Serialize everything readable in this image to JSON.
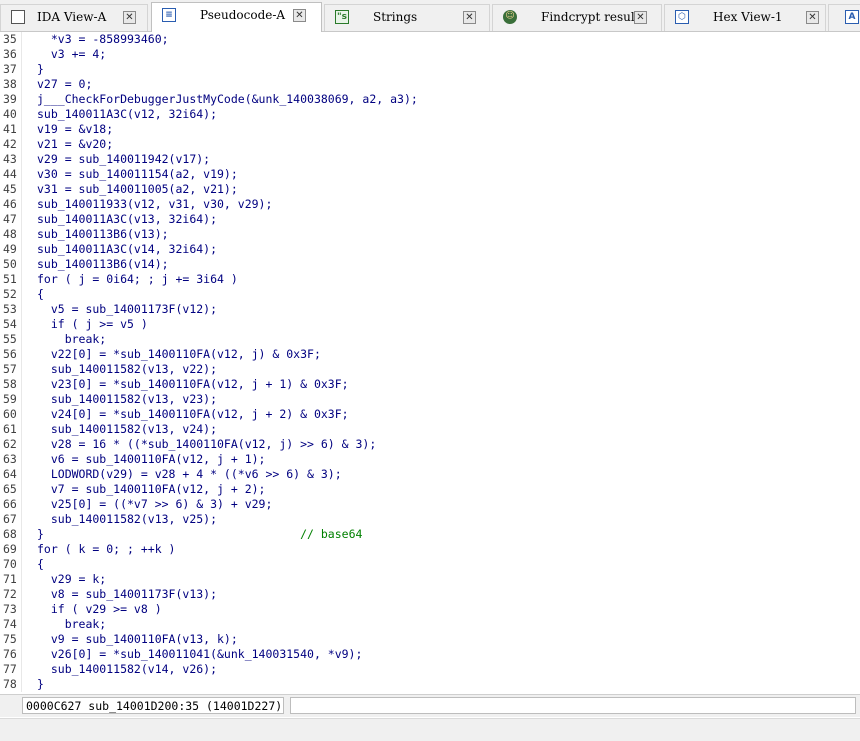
{
  "tabs": [
    {
      "label": "IDA View-A",
      "icon": "ida-view-icon",
      "active": false,
      "closable": true
    },
    {
      "label": "Pseudocode-A",
      "icon": "pseudocode-icon",
      "active": true,
      "closable": true
    },
    {
      "label": "Strings",
      "icon": "strings-icon",
      "active": false,
      "closable": true
    },
    {
      "label": "Findcrypt results",
      "icon": "findcrypt-icon",
      "active": false,
      "closable": true
    },
    {
      "label": "Hex View-1",
      "icon": "hex-view-icon",
      "active": false,
      "closable": true
    }
  ],
  "code_lines": [
    {
      "n": "35",
      "text": "  *v3 = -858993460;"
    },
    {
      "n": "36",
      "text": "  v3 += 4;"
    },
    {
      "n": "37",
      "text": "}"
    },
    {
      "n": "38",
      "text": "v27 = 0;"
    },
    {
      "n": "39",
      "text": "j___CheckForDebuggerJustMyCode(&unk_140038069, a2, a3);"
    },
    {
      "n": "40",
      "text": "sub_140011A3C(v12, 32i64);"
    },
    {
      "n": "41",
      "text": "v19 = &v18;"
    },
    {
      "n": "42",
      "text": "v21 = &v20;"
    },
    {
      "n": "43",
      "text": "v29 = sub_140011942(v17);"
    },
    {
      "n": "44",
      "text": "v30 = sub_140011154(a2, v19);"
    },
    {
      "n": "45",
      "text": "v31 = sub_140011005(a2, v21);"
    },
    {
      "n": "46",
      "text": "sub_140011933(v12, v31, v30, v29);"
    },
    {
      "n": "47",
      "text": "sub_140011A3C(v13, 32i64);"
    },
    {
      "n": "48",
      "text": "sub_1400113B6(v13);"
    },
    {
      "n": "49",
      "text": "sub_140011A3C(v14, 32i64);"
    },
    {
      "n": "50",
      "text": "sub_1400113B6(v14);"
    },
    {
      "n": "51",
      "text": "for ( j = 0i64; ; j += 3i64 )"
    },
    {
      "n": "52",
      "text": "{"
    },
    {
      "n": "53",
      "text": "  v5 = sub_14001173F(v12);"
    },
    {
      "n": "54",
      "text": "  if ( j >= v5 )"
    },
    {
      "n": "55",
      "text": "    break;"
    },
    {
      "n": "56",
      "text": "  v22[0] = *sub_1400110FA(v12, j) & 0x3F;"
    },
    {
      "n": "57",
      "text": "  sub_140011582(v13, v22);"
    },
    {
      "n": "58",
      "text": "  v23[0] = *sub_1400110FA(v12, j + 1) & 0x3F;"
    },
    {
      "n": "59",
      "text": "  sub_140011582(v13, v23);"
    },
    {
      "n": "60",
      "text": "  v24[0] = *sub_1400110FA(v12, j + 2) & 0x3F;"
    },
    {
      "n": "61",
      "text": "  sub_140011582(v13, v24);"
    },
    {
      "n": "62",
      "text": "  v28 = 16 * ((*sub_1400110FA(v12, j) >> 6) & 3);"
    },
    {
      "n": "63",
      "text": "  v6 = sub_1400110FA(v12, j + 1);"
    },
    {
      "n": "64",
      "text": "  LODWORD(v29) = v28 + 4 * ((*v6 >> 6) & 3);"
    },
    {
      "n": "65",
      "text": "  v7 = sub_1400110FA(v12, j + 2);"
    },
    {
      "n": "66",
      "text": "  v25[0] = ((*v7 >> 6) & 3) + v29;"
    },
    {
      "n": "67",
      "text": "  sub_140011582(v13, v25);"
    },
    {
      "n": "68",
      "text": "}                                     // base64"
    },
    {
      "n": "69",
      "text": "for ( k = 0; ; ++k )"
    },
    {
      "n": "70",
      "text": "{"
    },
    {
      "n": "71",
      "text": "  v29 = k;"
    },
    {
      "n": "72",
      "text": "  v8 = sub_14001173F(v13);"
    },
    {
      "n": "73",
      "text": "  if ( v29 >= v8 )"
    },
    {
      "n": "74",
      "text": "    break;"
    },
    {
      "n": "75",
      "text": "  v9 = sub_1400110FA(v13, k);"
    },
    {
      "n": "76",
      "text": "  v26[0] = *sub_140011041(&unk_140031540, *v9);"
    },
    {
      "n": "77",
      "text": "  sub_140011582(v14, v26);"
    },
    {
      "n": "78",
      "text": "}"
    }
  ],
  "status": {
    "text": "0000C627 sub_14001D200:35 (14001D227)"
  },
  "colors": {
    "code": "#000080",
    "line_number": "#404040",
    "comment": "#008000",
    "active_tab": "#ffffff"
  }
}
